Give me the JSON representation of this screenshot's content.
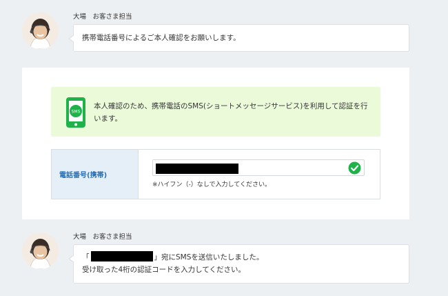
{
  "intro_message": {
    "agent_name": "大場　お客さま担当",
    "text": "携帯電話番号によるご本人確認をお願いします。"
  },
  "verification_card": {
    "sms_notice": {
      "icon": "sms-phone-icon",
      "icon_label": "SMS",
      "text": "本人確認のため、携帯電話のSMS(ショートメッセージサービス)を利用して認証を行います。"
    },
    "phone_field": {
      "label": "電話番号(携帯)",
      "value_redacted": true,
      "status_icon": "check-circle-icon",
      "hint": "※ハイフン（-）なしで入力してください。"
    }
  },
  "followup_message": {
    "agent_name": "大場　お客さま担当",
    "line1_prefix": "「",
    "line1_suffix": "」宛にSMSを送信いたしました。",
    "line2": "受け取った4桁の認証コードを入力してください。"
  },
  "colors": {
    "background": "#edf0f3",
    "notice_bg": "#ebfbd9",
    "accent_green": "#1fb14a",
    "label_bg": "#e4eff7",
    "label_text": "#2a6fb3"
  }
}
